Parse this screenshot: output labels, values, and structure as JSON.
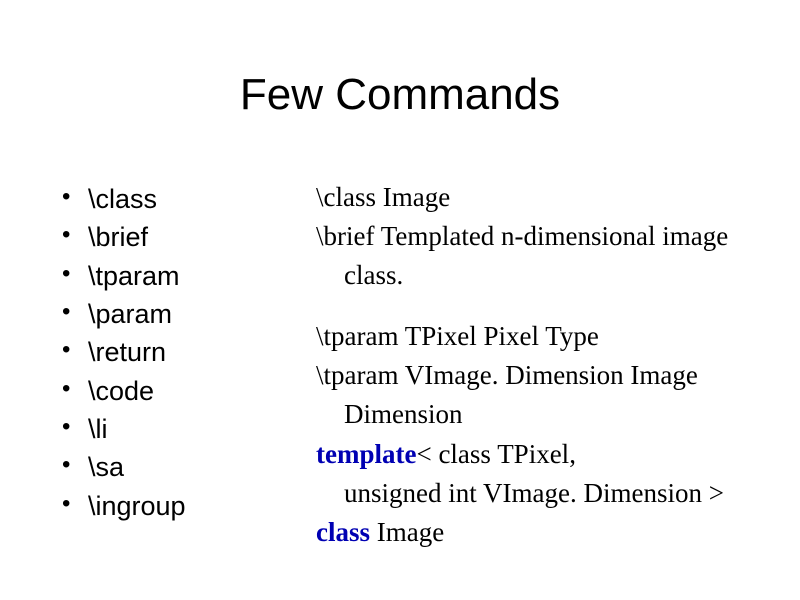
{
  "title": "Few Commands",
  "bullets": [
    "\\class",
    "\\brief",
    "\\tparam",
    "\\param",
    "\\return",
    "\\code",
    "\\li",
    "\\sa",
    "\\ingroup"
  ],
  "example": {
    "line1_cmd": "\\class",
    "line1_rest": " Image",
    "line2_cmd": "\\brief",
    "line2_rest": " Templated n-dimensional image",
    "line3_indent": "class.",
    "line4_cmd": "\\tparam",
    "line4_rest": " TPixel Pixel Type",
    "line5_cmd": "\\tparam",
    "line5_rest": " VImage. Dimension Image",
    "line6_indent": "Dimension",
    "line7_kw": "template",
    "line7_rest": "< class TPixel,",
    "line8_indent": "unsigned int VImage. Dimension >",
    "line9_kw": "class ",
    "line9_rest": "Image"
  }
}
